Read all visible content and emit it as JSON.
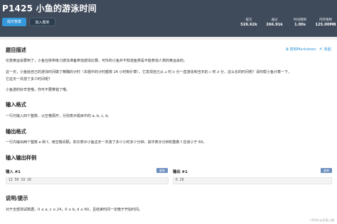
{
  "header": {
    "title": "P1425 小鱼的游泳时间",
    "submit_label": "提交答案",
    "add_label": "加入题单",
    "stats": [
      {
        "label": "提交",
        "value": "526.62k"
      },
      {
        "label": "通过",
        "value": "266.91k"
      },
      {
        "label": "时间限制",
        "value": "1.00s"
      },
      {
        "label": "内存限制",
        "value": "125.00MB"
      }
    ]
  },
  "toolbar": {
    "copy_markdown": "复制Markdown",
    "collapse": "收起"
  },
  "sections": {
    "desc_title": "题目描述",
    "desc_p1": "伦敦奥运会要到了，小鱼在拼命练习游泳准备参加游泳比赛，可怜的小鱼并不知道鱼类是不能参加人类的奥运会的。",
    "desc_p2_a": "这一天，小鱼给自己的游泳时间做了精确的计时（本题中的计时都按 24 小时制计算），它发现自己从",
    "desc_p2_b": "这么长的时间呢？请你帮小鱼计算一下，",
    "desc_p3": "它这天一共游了多少时间呢？",
    "desc_p4": "小鱼游的好辛苦哦，你可不要算错了哦。",
    "input_title": "输入格式",
    "input_text": "一行内输入四个整数，以空格隔开，分别表示题目中的 a, b, c, d。",
    "output_title": "输出格式",
    "output_text": "一行内输出两个整数 e 和 f，用空格间隔，依次表示小鱼这天一共游了多少小时多少分钟。其中表示分钟的整数 f 应该小于 60。",
    "sample_title": "输入输出样例",
    "input_label": "输入 #1",
    "output_label": "输出 #1",
    "copy_label": "复制",
    "input_value": "12 50 19 10",
    "output_value": "6 20",
    "hint_title": "说明/提示",
    "hint_text": "对于全部测试数据，0 ≤ a, c ≤ 24，0 ≤ b, d ≤ 60，且结束时间一定晚于开始时间。"
  },
  "watermark": "CSDN @哀哥心酸",
  "colors": {
    "header_bg": "#3f4a5b",
    "accent": "#3498db"
  }
}
